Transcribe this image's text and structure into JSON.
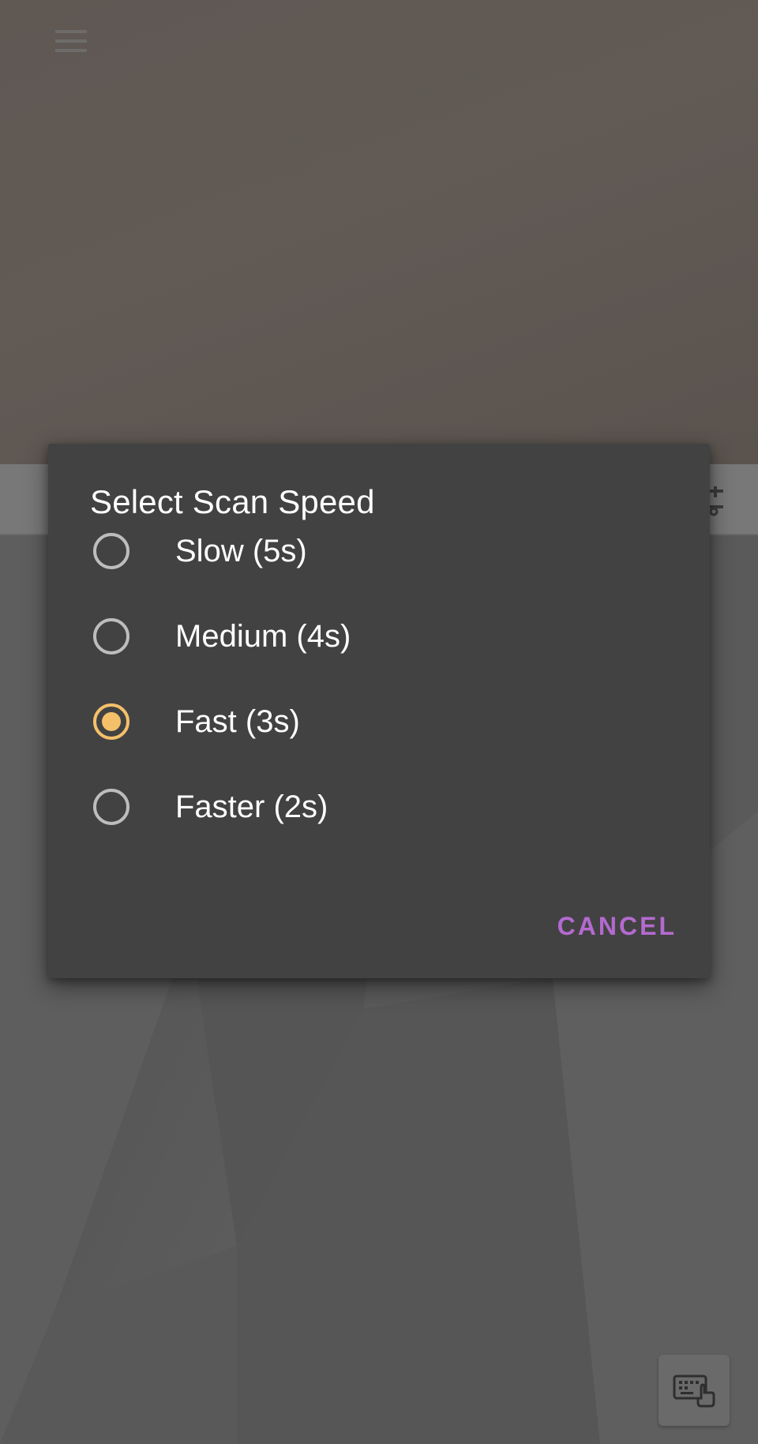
{
  "background": {
    "menu_icon": "hamburger-menu-icon",
    "toolbar_icon": "tune-icon",
    "fab_icon": "keyboard-touch-icon"
  },
  "dialog": {
    "title": "Select Scan Speed",
    "options": [
      {
        "label": "Slow (5s)",
        "selected": false
      },
      {
        "label": "Medium (4s)",
        "selected": false
      },
      {
        "label": "Fast (3s)",
        "selected": true
      },
      {
        "label": "Faster (2s)",
        "selected": false
      }
    ],
    "cancel_label": "CANCEL"
  },
  "colors": {
    "dialog_bg": "#424242",
    "radio_selected": "#f4c06a",
    "radio_unselected": "#bdbdbd",
    "action_accent": "#b46ad0"
  }
}
